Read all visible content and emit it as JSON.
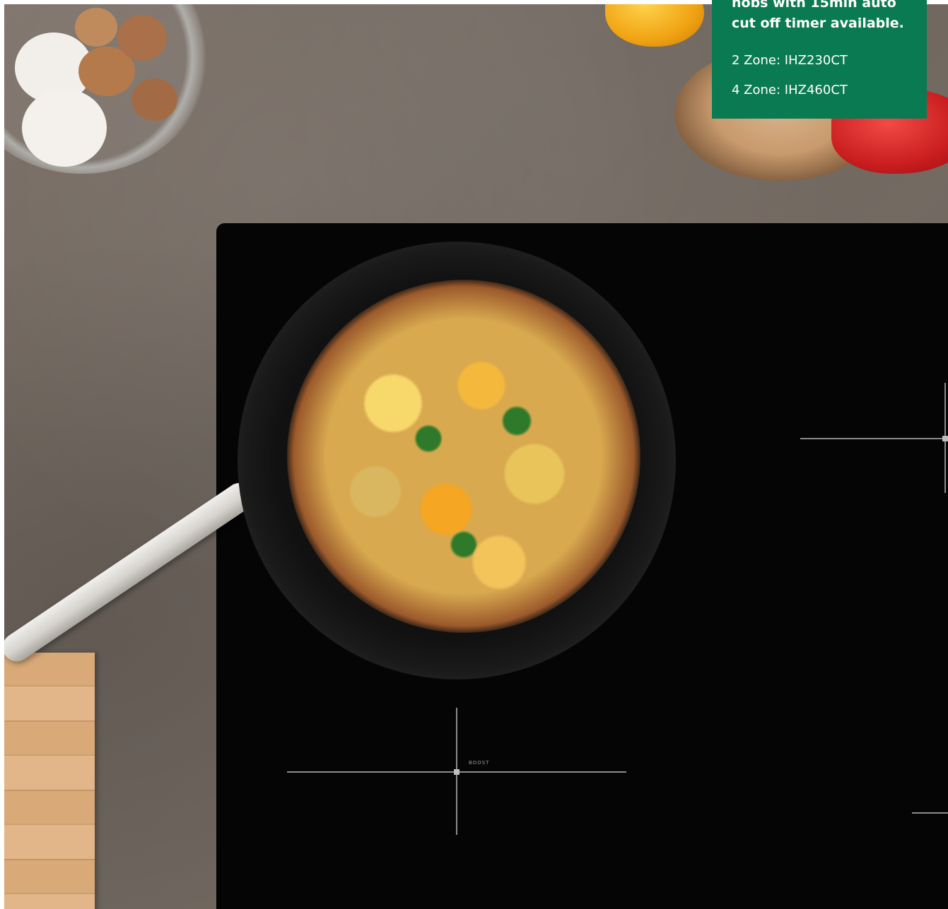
{
  "info_panel": {
    "headline_line1": "hobs with 15min auto",
    "headline_line2": "cut off timer available.",
    "model_2_zone": "2 Zone: IHZ230CT",
    "model_4_zone": "4 Zone: IHZ460CT",
    "background_color": "#0a7a52"
  },
  "hob": {
    "boost_label": "BOOST"
  }
}
